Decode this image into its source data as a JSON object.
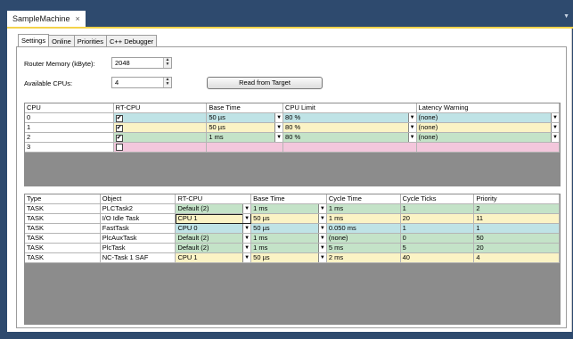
{
  "document_tab": {
    "title": "SampleMachine",
    "close": "×"
  },
  "settings_tabs": [
    {
      "label": "Settings",
      "active": true
    },
    {
      "label": "Online"
    },
    {
      "label": "Priorities"
    },
    {
      "label": "C++ Debugger"
    }
  ],
  "router_memory": {
    "label": "Router Memory (kByte):",
    "value": "2048"
  },
  "available_cpus": {
    "label": "Available CPUs:",
    "value": "4"
  },
  "read_button": "Read from Target",
  "cpu_table": {
    "columns": [
      "CPU",
      "RT-CPU",
      "Base Time",
      "CPU Limit",
      "Latency Warning"
    ],
    "rows": [
      {
        "cpu": "0",
        "rt": "✔",
        "base": "50 µs",
        "limit": "80 %",
        "latency": "(none)",
        "color": "cyan"
      },
      {
        "cpu": "1",
        "rt": "✔",
        "base": "50 µs",
        "limit": "80 %",
        "latency": "(none)",
        "color": "yellow"
      },
      {
        "cpu": "2",
        "rt": "✔",
        "base": "1 ms",
        "limit": "80 %",
        "latency": "(none)",
        "color": "green"
      },
      {
        "cpu": "3",
        "rt": "",
        "base": "",
        "limit": "",
        "latency": "",
        "color": "pink"
      }
    ]
  },
  "task_table": {
    "columns": [
      "Type",
      "Object",
      "RT-CPU",
      "Base Time",
      "Cycle Time",
      "Cycle Ticks",
      "Priority"
    ],
    "rows": [
      {
        "type": "TASK",
        "object": "PLCTask2",
        "rt": "Default (2)",
        "base": "1 ms",
        "cycle": "1 ms",
        "ticks": "1",
        "prio": "2",
        "color": "green"
      },
      {
        "type": "TASK",
        "object": "I/O Idle Task",
        "rt": "CPU 1",
        "base": "50 µs",
        "cycle": "1 ms",
        "ticks": "20",
        "prio": "11",
        "color": "yellow"
      },
      {
        "type": "TASK",
        "object": "FastTask",
        "rt": "CPU 0",
        "base": "50 µs",
        "cycle": "0.050 ms",
        "ticks": "1",
        "prio": "1",
        "color": "cyan"
      },
      {
        "type": "TASK",
        "object": "PlcAuxTask",
        "rt": "Default (2)",
        "base": "1 ms",
        "cycle": "(none)",
        "ticks": "0",
        "prio": "50",
        "color": "green"
      },
      {
        "type": "TASK",
        "object": "PlcTask",
        "rt": "Default (2)",
        "base": "1 ms",
        "cycle": "5 ms",
        "ticks": "5",
        "prio": "20",
        "color": "green"
      },
      {
        "type": "TASK",
        "object": "NC-Task 1 SAF",
        "rt": "CPU 1",
        "base": "50 µs",
        "cycle": "2 ms",
        "ticks": "40",
        "prio": "4",
        "color": "yellow"
      }
    ]
  },
  "colors": {
    "cyan": "#bfe3e6",
    "yellow": "#fbf3c5",
    "green": "#c4e3c8",
    "pink": "#f3c7dc",
    "accent": "#f4d34a"
  }
}
